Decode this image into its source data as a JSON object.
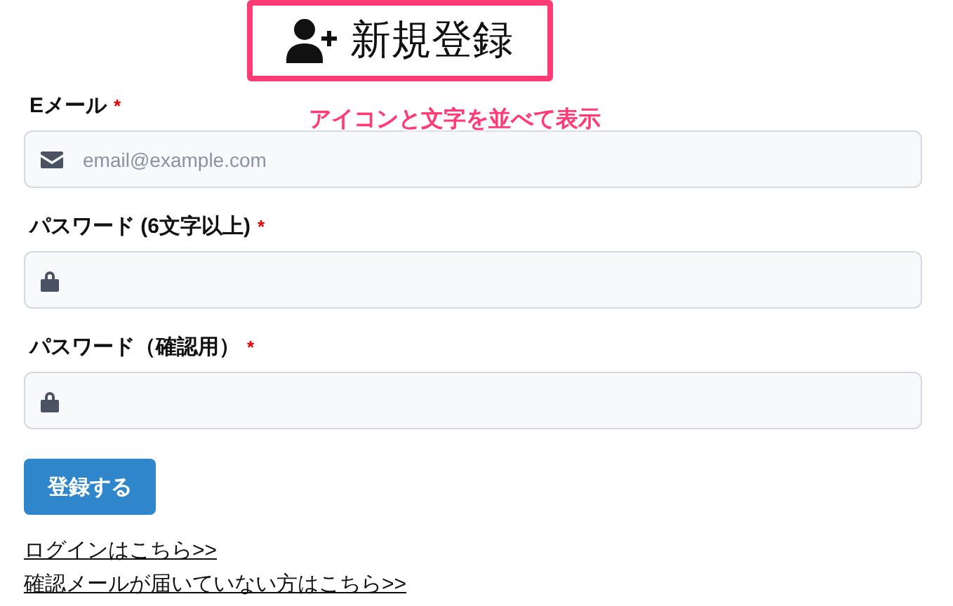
{
  "title": "新規登録",
  "annotation": "アイコンと文字を並べて表示",
  "fields": [
    {
      "label": "Eメール",
      "required_mark": "*",
      "kind": "email",
      "placeholder": "email@example.com"
    },
    {
      "label": "パスワード (6文字以上)",
      "required_mark": "*",
      "kind": "password"
    },
    {
      "label": "パスワード（確認用）",
      "required_mark": "*",
      "kind": "password"
    }
  ],
  "submit_button": "登録する",
  "links": [
    "ログインはこちら>>",
    "確認メールが届いていない方はこちら>>"
  ]
}
